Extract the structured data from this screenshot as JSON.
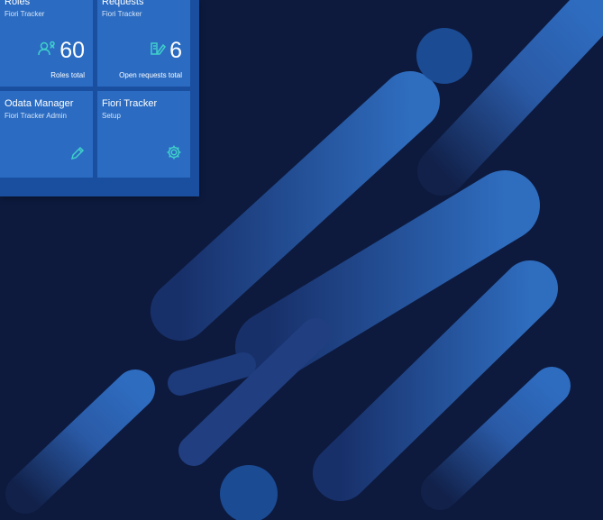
{
  "tiles": [
    {
      "title": "Roles",
      "subtitle": "Fiori Tracker",
      "value": "60",
      "footer": "Roles total",
      "icon": "user-role-icon"
    },
    {
      "title": "Requests",
      "subtitle": "Fiori Tracker",
      "value": "6",
      "footer": "Open requests total",
      "icon": "request-edit-icon"
    },
    {
      "title": "Odata Manager",
      "subtitle": "Fiori Tracker Admin",
      "icon": "pencil-icon"
    },
    {
      "title": "Fiori Tracker",
      "subtitle": "Setup",
      "icon": "gear-icon"
    }
  ],
  "colors": {
    "background": "#0d1a3e",
    "tile": "#2b6cc2",
    "tile_group": "#1a4fa0",
    "icon_accent": "#3fd0c9"
  }
}
